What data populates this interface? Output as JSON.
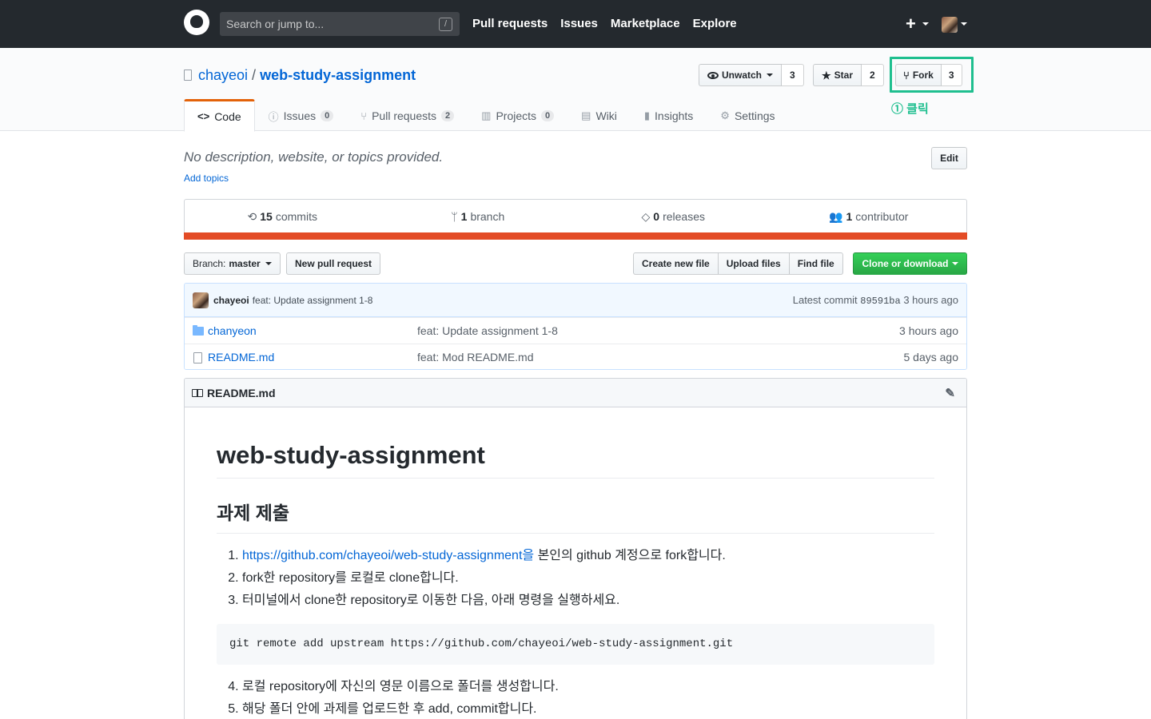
{
  "header": {
    "search_placeholder": "Search or jump to...",
    "search_shortcut": "/",
    "nav": [
      "Pull requests",
      "Issues",
      "Marketplace",
      "Explore"
    ],
    "plus_label": "+"
  },
  "repo": {
    "owner": "chayeoi",
    "separator": "/",
    "name": "web-study-assignment",
    "watch_label": "Unwatch",
    "watch_count": "3",
    "star_label": "Star",
    "star_count": "2",
    "fork_label": "Fork",
    "fork_count": "3",
    "annotation": "① 클릭",
    "annotation_color": "#1fbf8f"
  },
  "tabs": [
    {
      "label": "Code",
      "icon": "<>",
      "count": ""
    },
    {
      "label": "Issues",
      "icon": "ⓘ",
      "count": "0"
    },
    {
      "label": "Pull requests",
      "icon": "⑂",
      "count": "2"
    },
    {
      "label": "Projects",
      "icon": "▥",
      "count": "0"
    },
    {
      "label": "Wiki",
      "icon": "▤",
      "count": ""
    },
    {
      "label": "Insights",
      "icon": "▮",
      "count": ""
    },
    {
      "label": "Settings",
      "icon": "⚙",
      "count": ""
    }
  ],
  "about": {
    "description": "No description, website, or topics provided.",
    "add_topics": "Add topics",
    "edit_label": "Edit"
  },
  "summary": [
    {
      "icon": "history-icon",
      "num": "15",
      "label": "commits"
    },
    {
      "icon": "branch-icon",
      "num": "1",
      "label": "branch"
    },
    {
      "icon": "tag-icon",
      "num": "0",
      "label": "releases"
    },
    {
      "icon": "people-icon",
      "num": "1",
      "label": "contributor"
    }
  ],
  "language_bar_color": "#e34c26",
  "file_nav": {
    "branch_prefix": "Branch:",
    "branch": "master",
    "new_pr": "New pull request",
    "create_file": "Create new file",
    "upload_files": "Upload files",
    "find_file": "Find file",
    "clone": "Clone or download"
  },
  "commit": {
    "author": "chayeoi",
    "message": "feat: Update assignment 1-8",
    "latest_prefix": "Latest commit",
    "sha": "89591ba",
    "age": "3 hours ago"
  },
  "files": [
    {
      "type": "folder",
      "name": "chanyeon",
      "message": "feat: Update assignment 1-8",
      "age": "3 hours ago"
    },
    {
      "type": "file",
      "name": "README.md",
      "message": "feat: Mod README.md",
      "age": "5 days ago"
    }
  ],
  "readme": {
    "filename": "README.md",
    "h1": "web-study-assignment",
    "h2": "과제 제출",
    "steps1": [
      {
        "link": "https://github.com/chayeoi/web-study-assignment을",
        "text": " 본인의 github 계정으로 fork합니다."
      },
      {
        "link": "",
        "text": "fork한 repository를 로컬로 clone합니다."
      },
      {
        "link": "",
        "text": "터미널에서 clone한 repository로 이동한 다음, 아래 명령을 실행하세요."
      }
    ],
    "code": "git remote add upstream https://github.com/chayeoi/web-study-assignment.git",
    "steps2": [
      "로컬 repository에 자신의 영문 이름으로 폴더를 생성합니다.",
      "해당 폴더 안에 과제를 업로드한 후 add, commit합니다."
    ]
  }
}
